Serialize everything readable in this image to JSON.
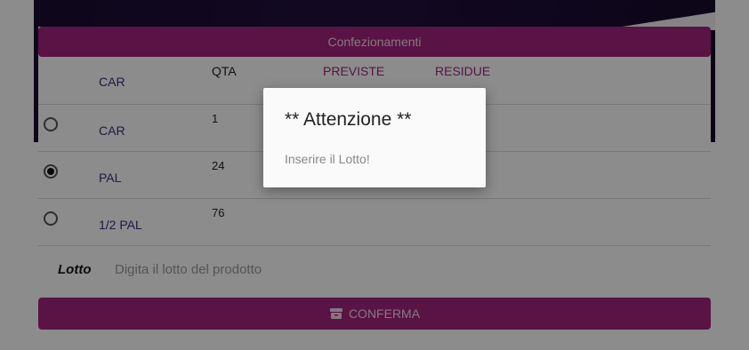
{
  "section": {
    "title": "Confezionamenti"
  },
  "columns": {
    "pack": "CAR",
    "qta": "QTA",
    "previste": "PREVISTE",
    "residue": "RESIDUE"
  },
  "rows": [
    {
      "pack": "CAR",
      "qta": "1",
      "selected": false
    },
    {
      "pack": "PAL",
      "qta": "24",
      "selected": true
    },
    {
      "pack": "1/2 PAL",
      "qta": "76",
      "selected": false
    }
  ],
  "lotto": {
    "label": "Lotto",
    "placeholder": "Digita il lotto del prodotto",
    "value": ""
  },
  "confirm": {
    "label": "CONFERMA",
    "icon": "archive-icon"
  },
  "dialog": {
    "title": "** Attenzione **",
    "message": "Inserire il Lotto!"
  },
  "colors": {
    "accent": "#a3237c",
    "header_bg": "#1a0c30",
    "pack_text": "#3a2d7a",
    "column_accent": "#a3237c"
  }
}
